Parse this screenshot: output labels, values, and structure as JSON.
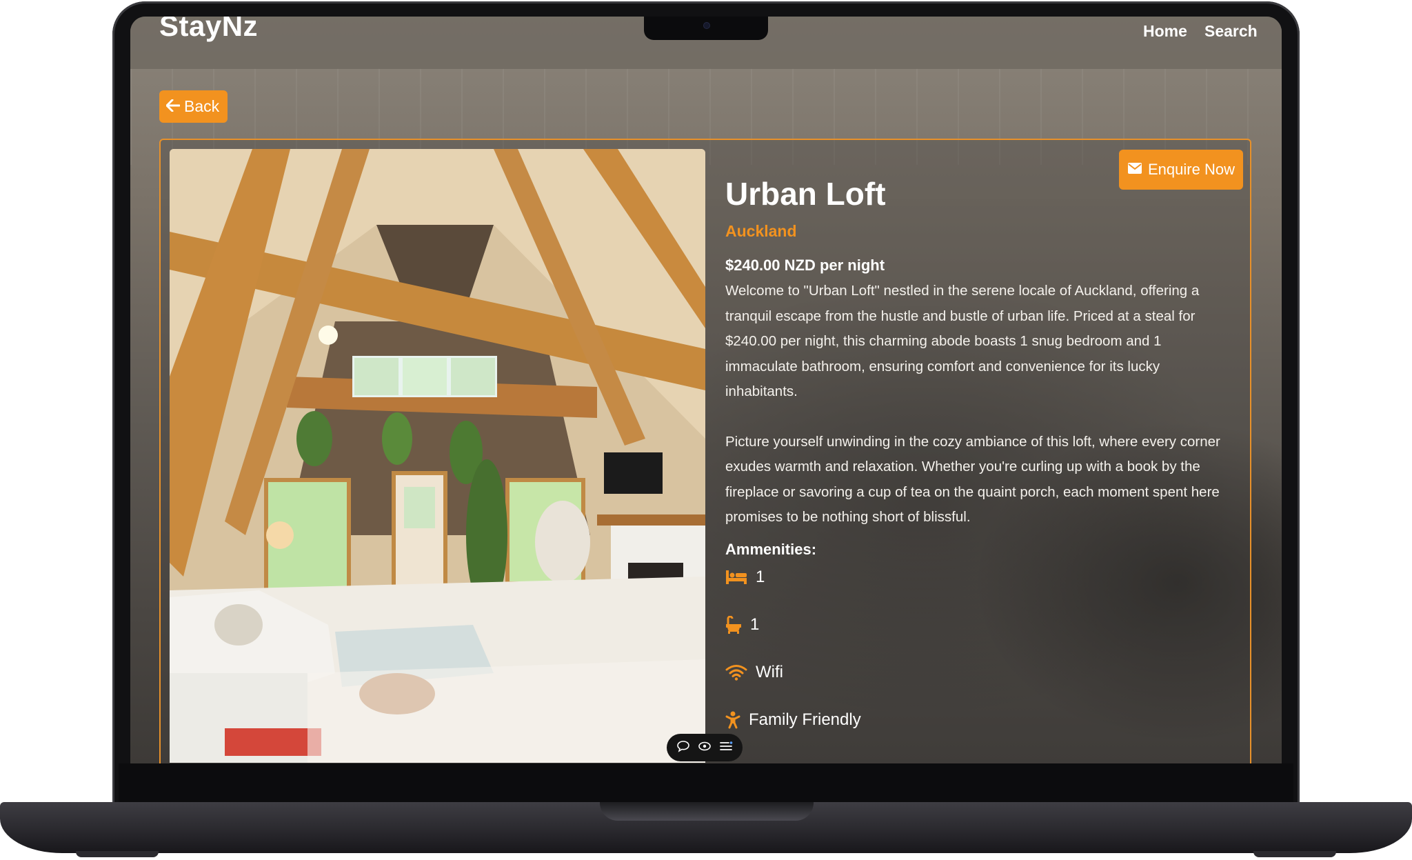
{
  "navbar": {
    "brand": "StayNz",
    "links": [
      {
        "label": "Home"
      },
      {
        "label": "Search"
      }
    ]
  },
  "back_button": {
    "label": "Back",
    "icon": "arrow-left-icon"
  },
  "enquire_button": {
    "label": "Enquire Now",
    "icon": "envelope-icon"
  },
  "listing": {
    "title": "Urban Loft",
    "location": "Auckland",
    "price": "$240.00 NZD per night",
    "description": [
      "Welcome to \"Urban Loft\" nestled in the serene locale of Auckland, offering a tranquil escape from the hustle and bustle of urban life. Priced at a steal for $240.00 per night, this charming abode boasts 1 snug bedroom and 1 immaculate bathroom, ensuring comfort and convenience for its lucky inhabitants.",
      "Picture yourself unwinding in the cozy ambiance of this loft, where every corner exudes warmth and relaxation. Whether you're curling up with a book by the fireplace or savoring a cup of tea on the quaint porch, each moment spent here promises to be nothing short of blissful."
    ],
    "amenities_title": "Ammenities:",
    "amenities": [
      {
        "icon": "bed-icon",
        "label": "1"
      },
      {
        "icon": "bath-icon",
        "label": "1"
      },
      {
        "icon": "wifi-icon",
        "label": "Wifi"
      },
      {
        "icon": "child-icon",
        "label": "Family Friendly"
      }
    ]
  },
  "colors": {
    "accent": "#f2921f",
    "text": "#ffffff"
  }
}
